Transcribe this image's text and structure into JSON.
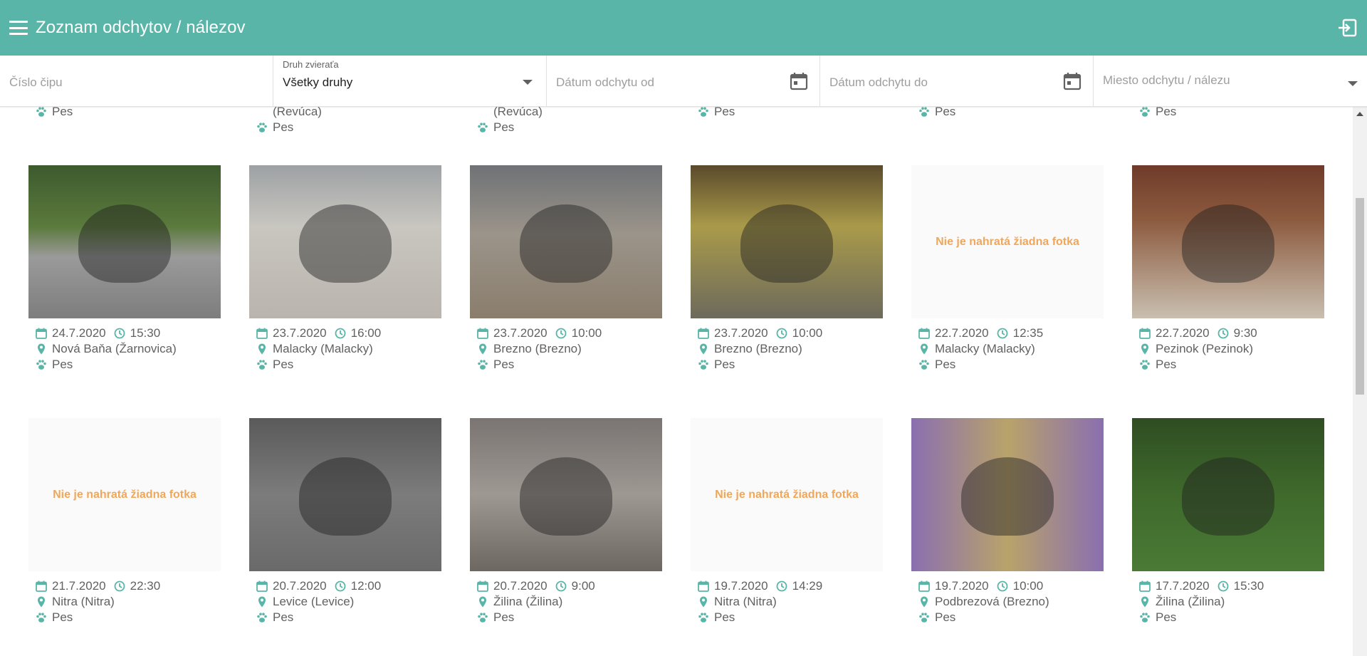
{
  "app": {
    "title": "Zoznam odchytov / nálezov"
  },
  "filters": {
    "chip_placeholder": "Číslo čipu",
    "species_label": "Druh zvieraťa",
    "species_value": "Všetky druhy",
    "date_from_placeholder": "Dátum odchytu od",
    "date_to_placeholder": "Dátum odchytu do",
    "place_placeholder": "Miesto odchytu / nálezu"
  },
  "no_photo_text": "Nie je nahratá žiadna fotka",
  "colors": {
    "appbar": "#59b5a8",
    "icon": "#59b5a8",
    "no_photo_text": "#f0a75a"
  },
  "partial_row": [
    {
      "place": "",
      "species": "Pes"
    },
    {
      "place": "(Revúca)",
      "species": "Pes"
    },
    {
      "place": "(Revúca)",
      "species": "Pes"
    },
    {
      "place": "",
      "species": "Pes"
    },
    {
      "place": "",
      "species": "Pes"
    },
    {
      "place": "",
      "species": "Pes"
    }
  ],
  "cards": [
    {
      "date": "24.7.2020",
      "time": "15:30",
      "place": "Nová Baňa (Žarnovica)",
      "species": "Pes",
      "has_photo": true
    },
    {
      "date": "23.7.2020",
      "time": "16:00",
      "place": "Malacky (Malacky)",
      "species": "Pes",
      "has_photo": true
    },
    {
      "date": "23.7.2020",
      "time": "10:00",
      "place": "Brezno (Brezno)",
      "species": "Pes",
      "has_photo": true
    },
    {
      "date": "23.7.2020",
      "time": "10:00",
      "place": "Brezno (Brezno)",
      "species": "Pes",
      "has_photo": true
    },
    {
      "date": "22.7.2020",
      "time": "12:35",
      "place": "Malacky (Malacky)",
      "species": "Pes",
      "has_photo": false
    },
    {
      "date": "22.7.2020",
      "time": "9:30",
      "place": "Pezinok (Pezinok)",
      "species": "Pes",
      "has_photo": true
    },
    {
      "date": "21.7.2020",
      "time": "22:30",
      "place": "Nitra (Nitra)",
      "species": "Pes",
      "has_photo": false
    },
    {
      "date": "20.7.2020",
      "time": "12:00",
      "place": "Levice (Levice)",
      "species": "Pes",
      "has_photo": true
    },
    {
      "date": "20.7.2020",
      "time": "9:00",
      "place": "Žilina (Žilina)",
      "species": "Pes",
      "has_photo": true
    },
    {
      "date": "19.7.2020",
      "time": "14:29",
      "place": "Nitra (Nitra)",
      "species": "Pes",
      "has_photo": false
    },
    {
      "date": "19.7.2020",
      "time": "10:00",
      "place": "Podbrezová (Brezno)",
      "species": "Pes",
      "has_photo": true
    },
    {
      "date": "17.7.2020",
      "time": "15:30",
      "place": "Žilina (Žilina)",
      "species": "Pes",
      "has_photo": true
    }
  ]
}
